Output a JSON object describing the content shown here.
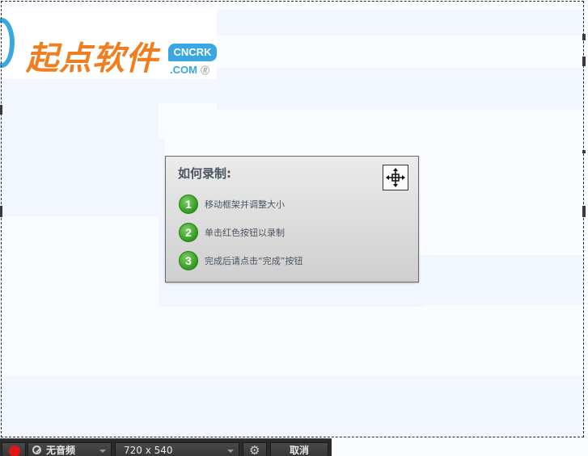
{
  "logo": {
    "text": "起点软件",
    "badge": "CNCRK",
    "domain": ".COM",
    "mark": "🄬"
  },
  "instructions": {
    "title": "如何录制:",
    "steps": [
      {
        "num": "1",
        "text": "移动框架并调整大小"
      },
      {
        "num": "2",
        "text": "单击红色按钮以录制"
      },
      {
        "num": "3",
        "text": "完成后请点击“完成”按钮"
      }
    ]
  },
  "toolbar": {
    "audio_label": "无音频",
    "size_label": "720 x 540",
    "cancel_label": "取消",
    "gear_glyph": "⚙"
  },
  "colors": {
    "record": "#e01515",
    "logo_orange": "#f07e1e",
    "logo_blue": "#3aa6e2",
    "step_green": "#2f9a1e"
  }
}
